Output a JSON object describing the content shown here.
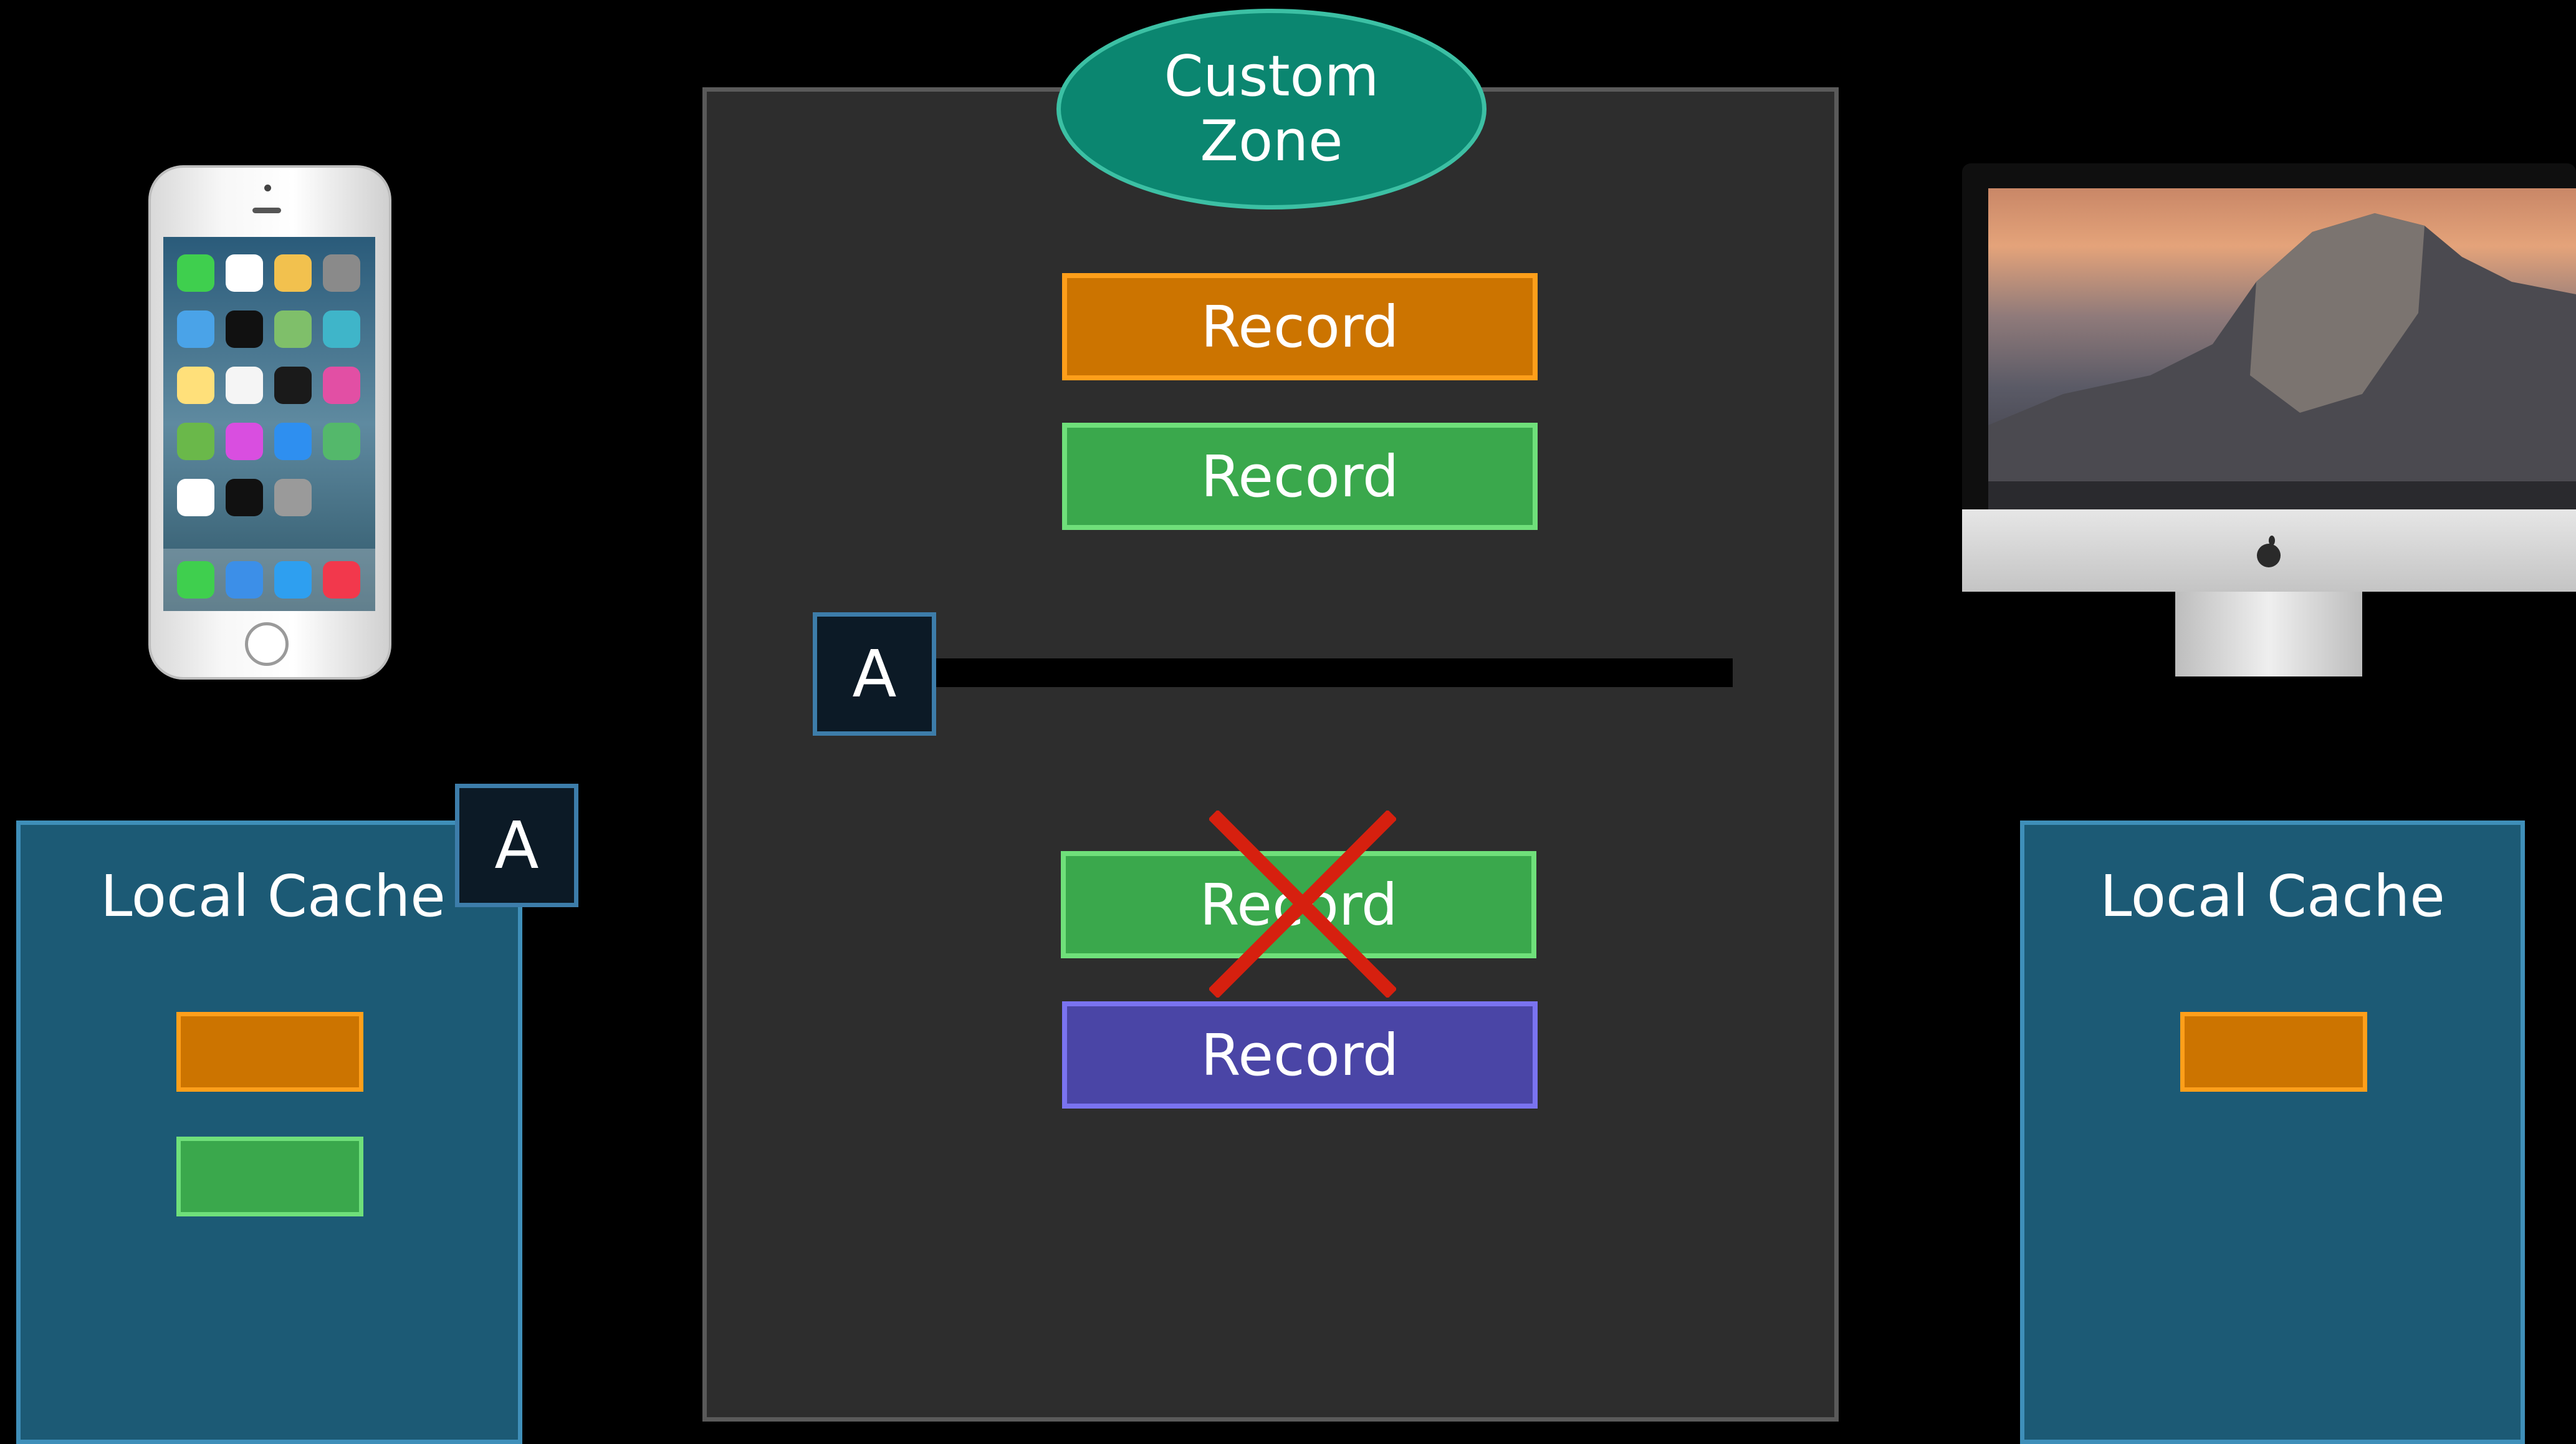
{
  "zone": {
    "title_line1": "Custom",
    "title_line2": "Zone"
  },
  "records": [
    {
      "label": "Record",
      "color": "orange"
    },
    {
      "label": "Record",
      "color": "green"
    },
    {
      "label": "Record",
      "color": "green",
      "deleted": true
    },
    {
      "label": "Record",
      "color": "purple"
    }
  ],
  "change_token": {
    "label": "A"
  },
  "left_cache": {
    "title": "Local Cache",
    "token": "A"
  },
  "right_cache": {
    "title": "Local Cache"
  },
  "colors": {
    "orange": "#cc7400",
    "green": "#3aa84c",
    "purple": "#4a45a6",
    "teal": "#0b8670",
    "delete_mark": "#d6200f"
  },
  "icons": {
    "left_device": "iphone-icon",
    "right_device": "imac-icon",
    "deleted_record": "x-mark-icon"
  }
}
